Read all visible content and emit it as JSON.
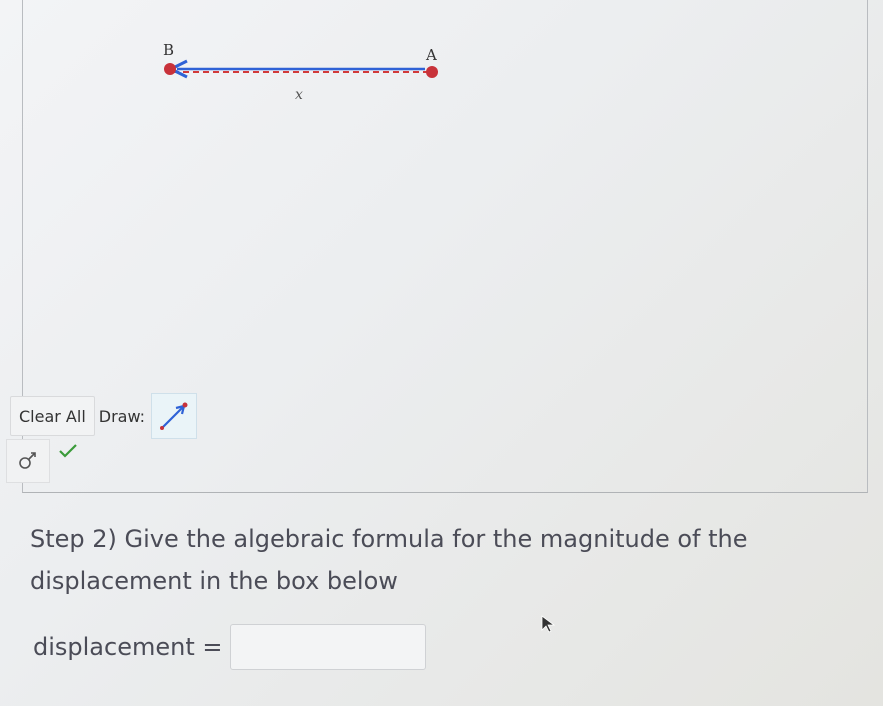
{
  "canvas": {
    "point_b_label": "B",
    "point_a_label": "A",
    "midpoint_label": "x",
    "vector_color": "#2f62d6",
    "dash_color": "#d23a3a",
    "point_color": "#c8323a"
  },
  "toolbar": {
    "clear_all_label": "Clear All",
    "draw_label": "Draw:",
    "draw_tool_icon": "vector-arrow-icon"
  },
  "controls": {
    "link_icon": "link-chain-icon",
    "status_icon": "checkmark-icon",
    "status_color": "#3a9b3a"
  },
  "question": {
    "text": "Step 2) Give the algebraic formula for the magnitude of the displacement in the box below"
  },
  "answer": {
    "label": "displacement =",
    "value": "",
    "placeholder": ""
  }
}
